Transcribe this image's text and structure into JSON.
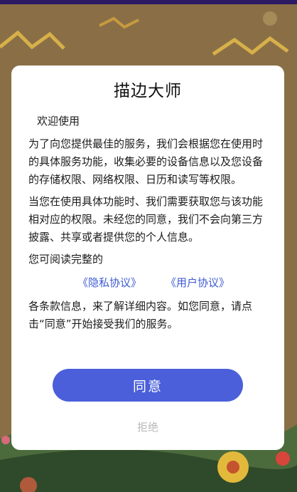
{
  "dialog": {
    "title": "描边大师",
    "welcome": "欢迎使用",
    "para1": "为了向您提供最佳的服务，我们会根据您在使用时的具体服务功能，收集必要的设备信息以及您设备的存储权限、网络权限、日历和读写等权限。",
    "para2": "当您在使用具体功能时、我们需要获取您与该功能相对应的权限。未经您的同意，我们不会向第三方披露、共享或者提供您的个人信息。",
    "read_prompt": "您可阅读完整的",
    "privacy_link": "《隐私协议》",
    "user_link": "《用户协议》",
    "para3": "各条款信息，来了解详细内容。如您同意，请点击“同意”开始接受我们的服务。",
    "agree_label": "同意",
    "reject_label": "拒绝"
  },
  "colors": {
    "accent": "#4a5fd9",
    "link": "#3d5bd3",
    "overlay_bg": "#8a6f46",
    "reject_text": "#b8b8b8"
  }
}
